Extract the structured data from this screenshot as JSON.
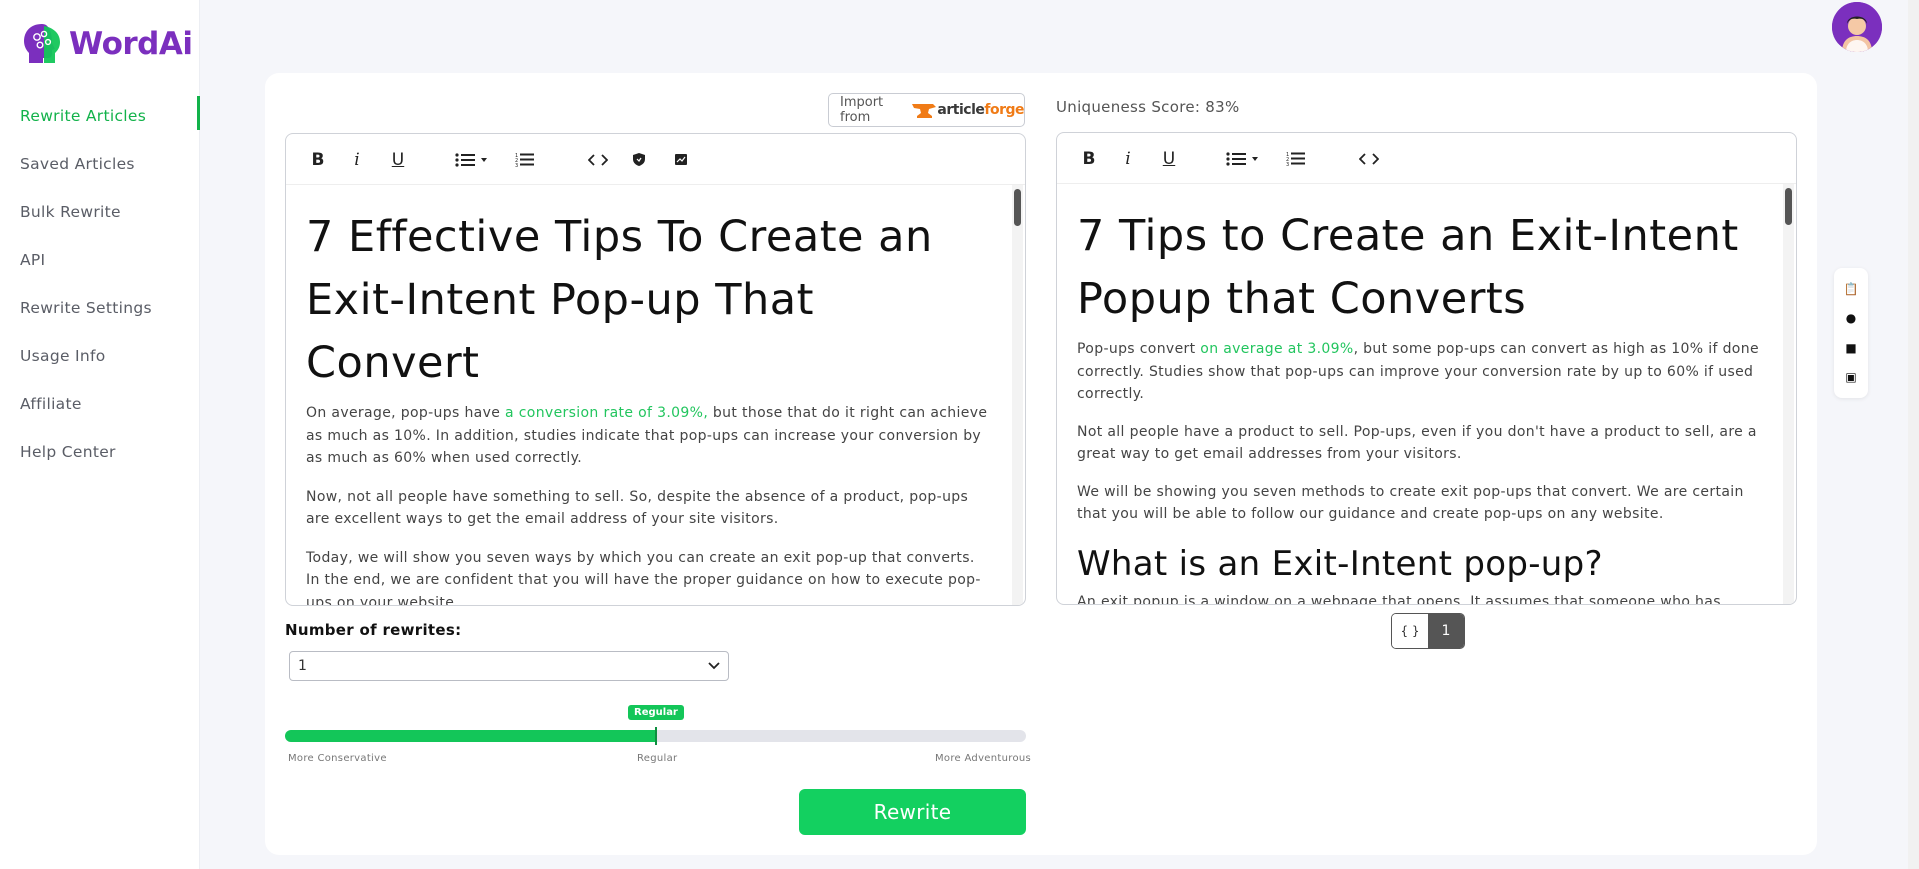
{
  "app": {
    "name": "WordAi"
  },
  "sidebar": {
    "items": [
      {
        "label": "Rewrite Articles",
        "active": true
      },
      {
        "label": "Saved Articles"
      },
      {
        "label": "Bulk Rewrite"
      },
      {
        "label": "API"
      },
      {
        "label": "Rewrite Settings"
      },
      {
        "label": "Usage Info"
      },
      {
        "label": "Affiliate"
      },
      {
        "label": "Help Center"
      }
    ]
  },
  "import": {
    "label": "Import from",
    "brand_a": "article",
    "brand_b": "forge"
  },
  "uniqueness": {
    "label": "Uniqueness Score: 83%"
  },
  "left_editor": {
    "title": "7 Effective Tips To Create an Exit-Intent Pop-up That Convert",
    "p1_pre": "On average, pop-ups have ",
    "p1_link": "a conversion rate of 3.09%,",
    "p1_post": " but those that do it right can achieve as much as 10%. In addition, studies indicate that pop-ups can increase your conversion by as much as 60% when used correctly.",
    "p2": "Now, not all people have something to sell. So, despite the absence of a product, pop-ups are excellent ways to get the email address of your site visitors.",
    "p3": "Today, we will show you seven ways by which you can create an exit pop-up that converts. In the end, we are confident that you will have the proper guidance on how to execute pop-ups on your website."
  },
  "right_editor": {
    "title": "7 Tips to Create an Exit-Intent Popup that Converts",
    "p1_pre": "Pop-ups convert ",
    "p1_link": "on average at 3.09%",
    "p1_post": ", but some pop-ups can convert as high as 10% if done correctly. Studies show that pop-ups can improve your conversion rate by up to 60% if used correctly.",
    "p2": "Not all people have a product to sell. Pop-ups, even if you don't have a product to sell, are a great way to get email addresses from your visitors.",
    "p3": "We will be showing you seven methods to create exit pop-ups that convert. We are certain that you will be able to follow our guidance and create pop-ups on any website.",
    "h2": "What is an Exit-Intent pop-up?",
    "p4": "An exit popup is a window on a webpage that opens. It assumes that someone who has visited"
  },
  "rewrites": {
    "label": "Number of rewrites:",
    "value": "1"
  },
  "slider": {
    "badge": "Regular",
    "value_fraction": 0.5,
    "min_label": "More Conservative",
    "mid_label": "Regular",
    "max_label": "More Adventurous"
  },
  "rewrite_button": {
    "label": "Rewrite"
  },
  "pager": {
    "code": "{ }",
    "page": "1"
  },
  "colors": {
    "accent": "#13c659",
    "brand": "#7b2fbe",
    "link": "#22c55e"
  }
}
